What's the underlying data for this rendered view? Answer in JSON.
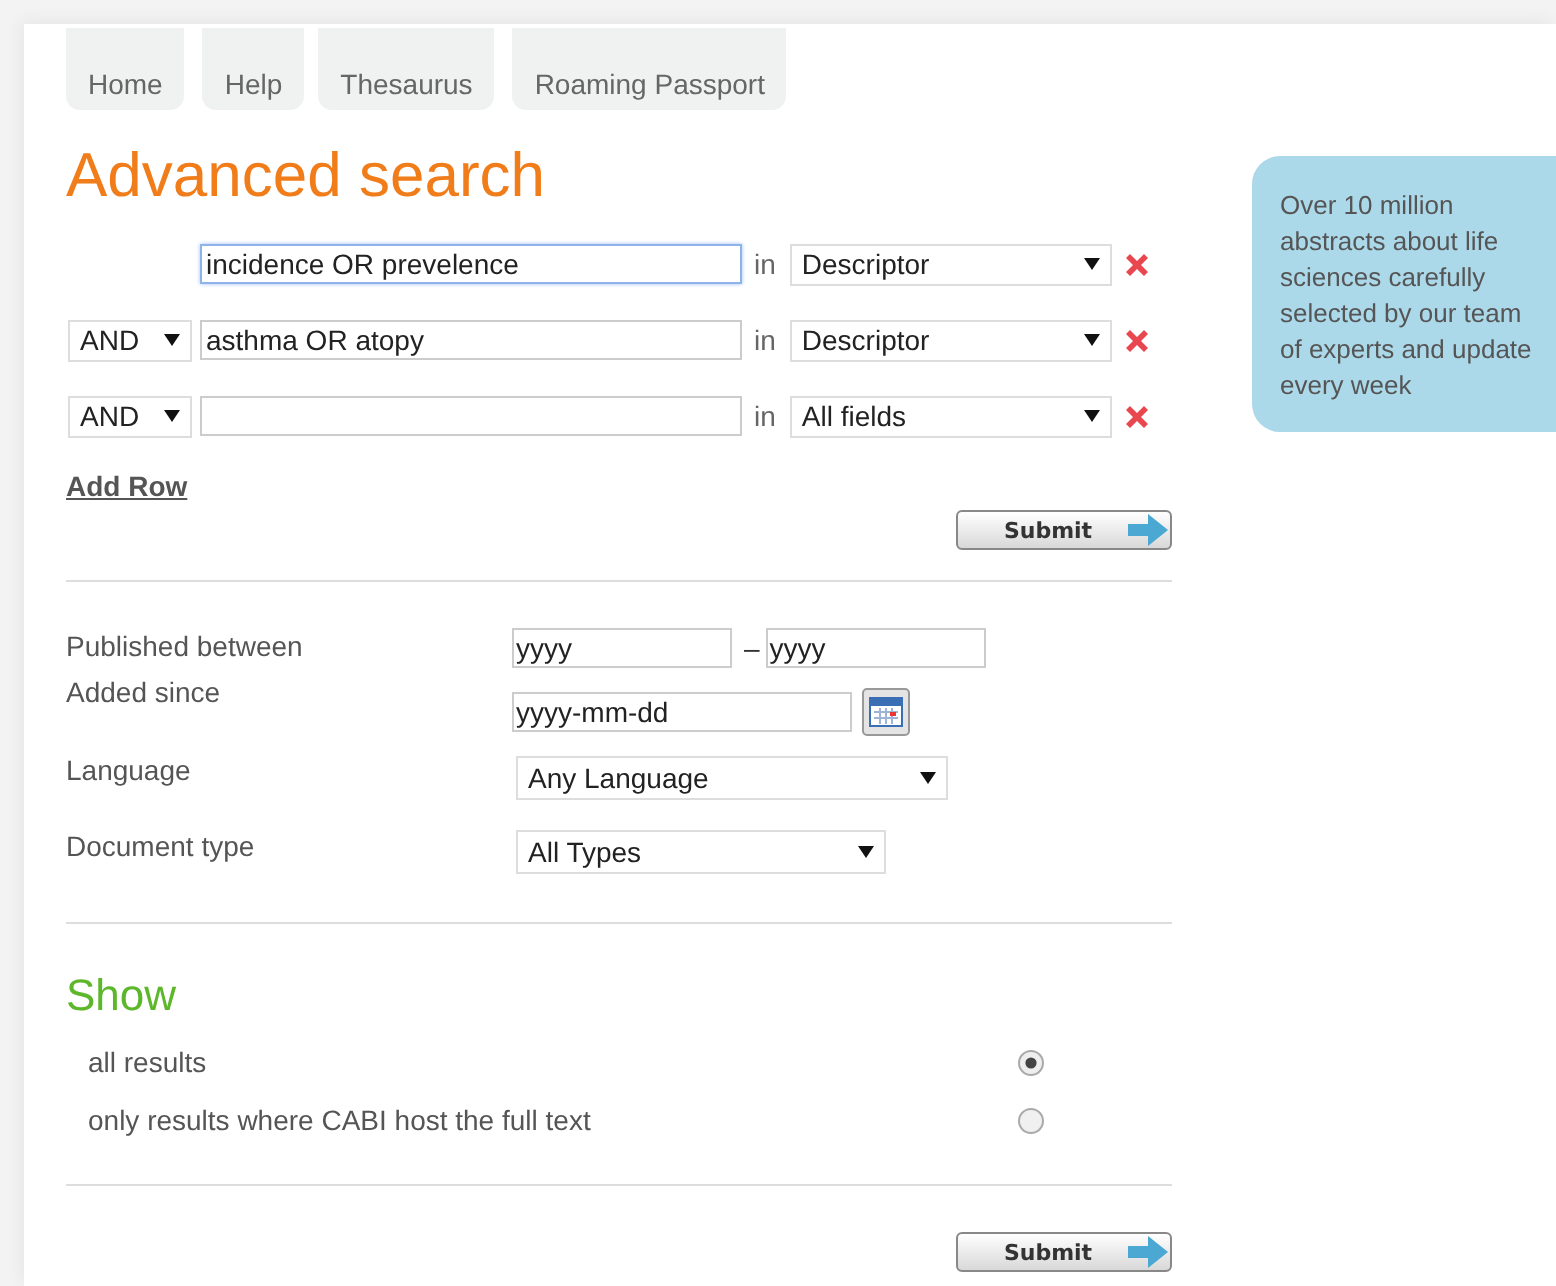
{
  "tabs": [
    {
      "label": "Home"
    },
    {
      "label": "Help"
    },
    {
      "label": "Thesaurus"
    },
    {
      "label": "Roaming Passport"
    }
  ],
  "title": "Advanced search",
  "search_rows": [
    {
      "term": "incidence OR prevelence",
      "focused": true,
      "in_label": "in",
      "field": "Descriptor"
    },
    {
      "operator": "AND",
      "term": "asthma OR atopy",
      "focused": false,
      "in_label": "in",
      "field": "Descriptor"
    },
    {
      "operator": "AND",
      "term": "",
      "focused": false,
      "in_label": "in",
      "field": "All fields"
    }
  ],
  "add_row": "Add Row",
  "submit_top": "Submit",
  "info_box": {
    "lines": [
      "Over 10 million",
      "abstracts about life",
      "sciences carefully",
      "selected by our team",
      "of experts and update",
      "every week"
    ]
  },
  "published_between": {
    "label": "Published between",
    "from": "yyyy",
    "separator": "–",
    "to": "yyyy"
  },
  "added_since": {
    "label": "Added since",
    "value": "yyyy-mm-dd"
  },
  "language": {
    "label": "Language",
    "value": "Any Language"
  },
  "document_type": {
    "label": "Document type",
    "value": "All Types"
  },
  "show": {
    "heading": "Show",
    "options": [
      {
        "label": "all results",
        "selected": true
      },
      {
        "label": "only results where CABI host the full text",
        "selected": false
      }
    ]
  },
  "submit_bottom": "Submit"
}
